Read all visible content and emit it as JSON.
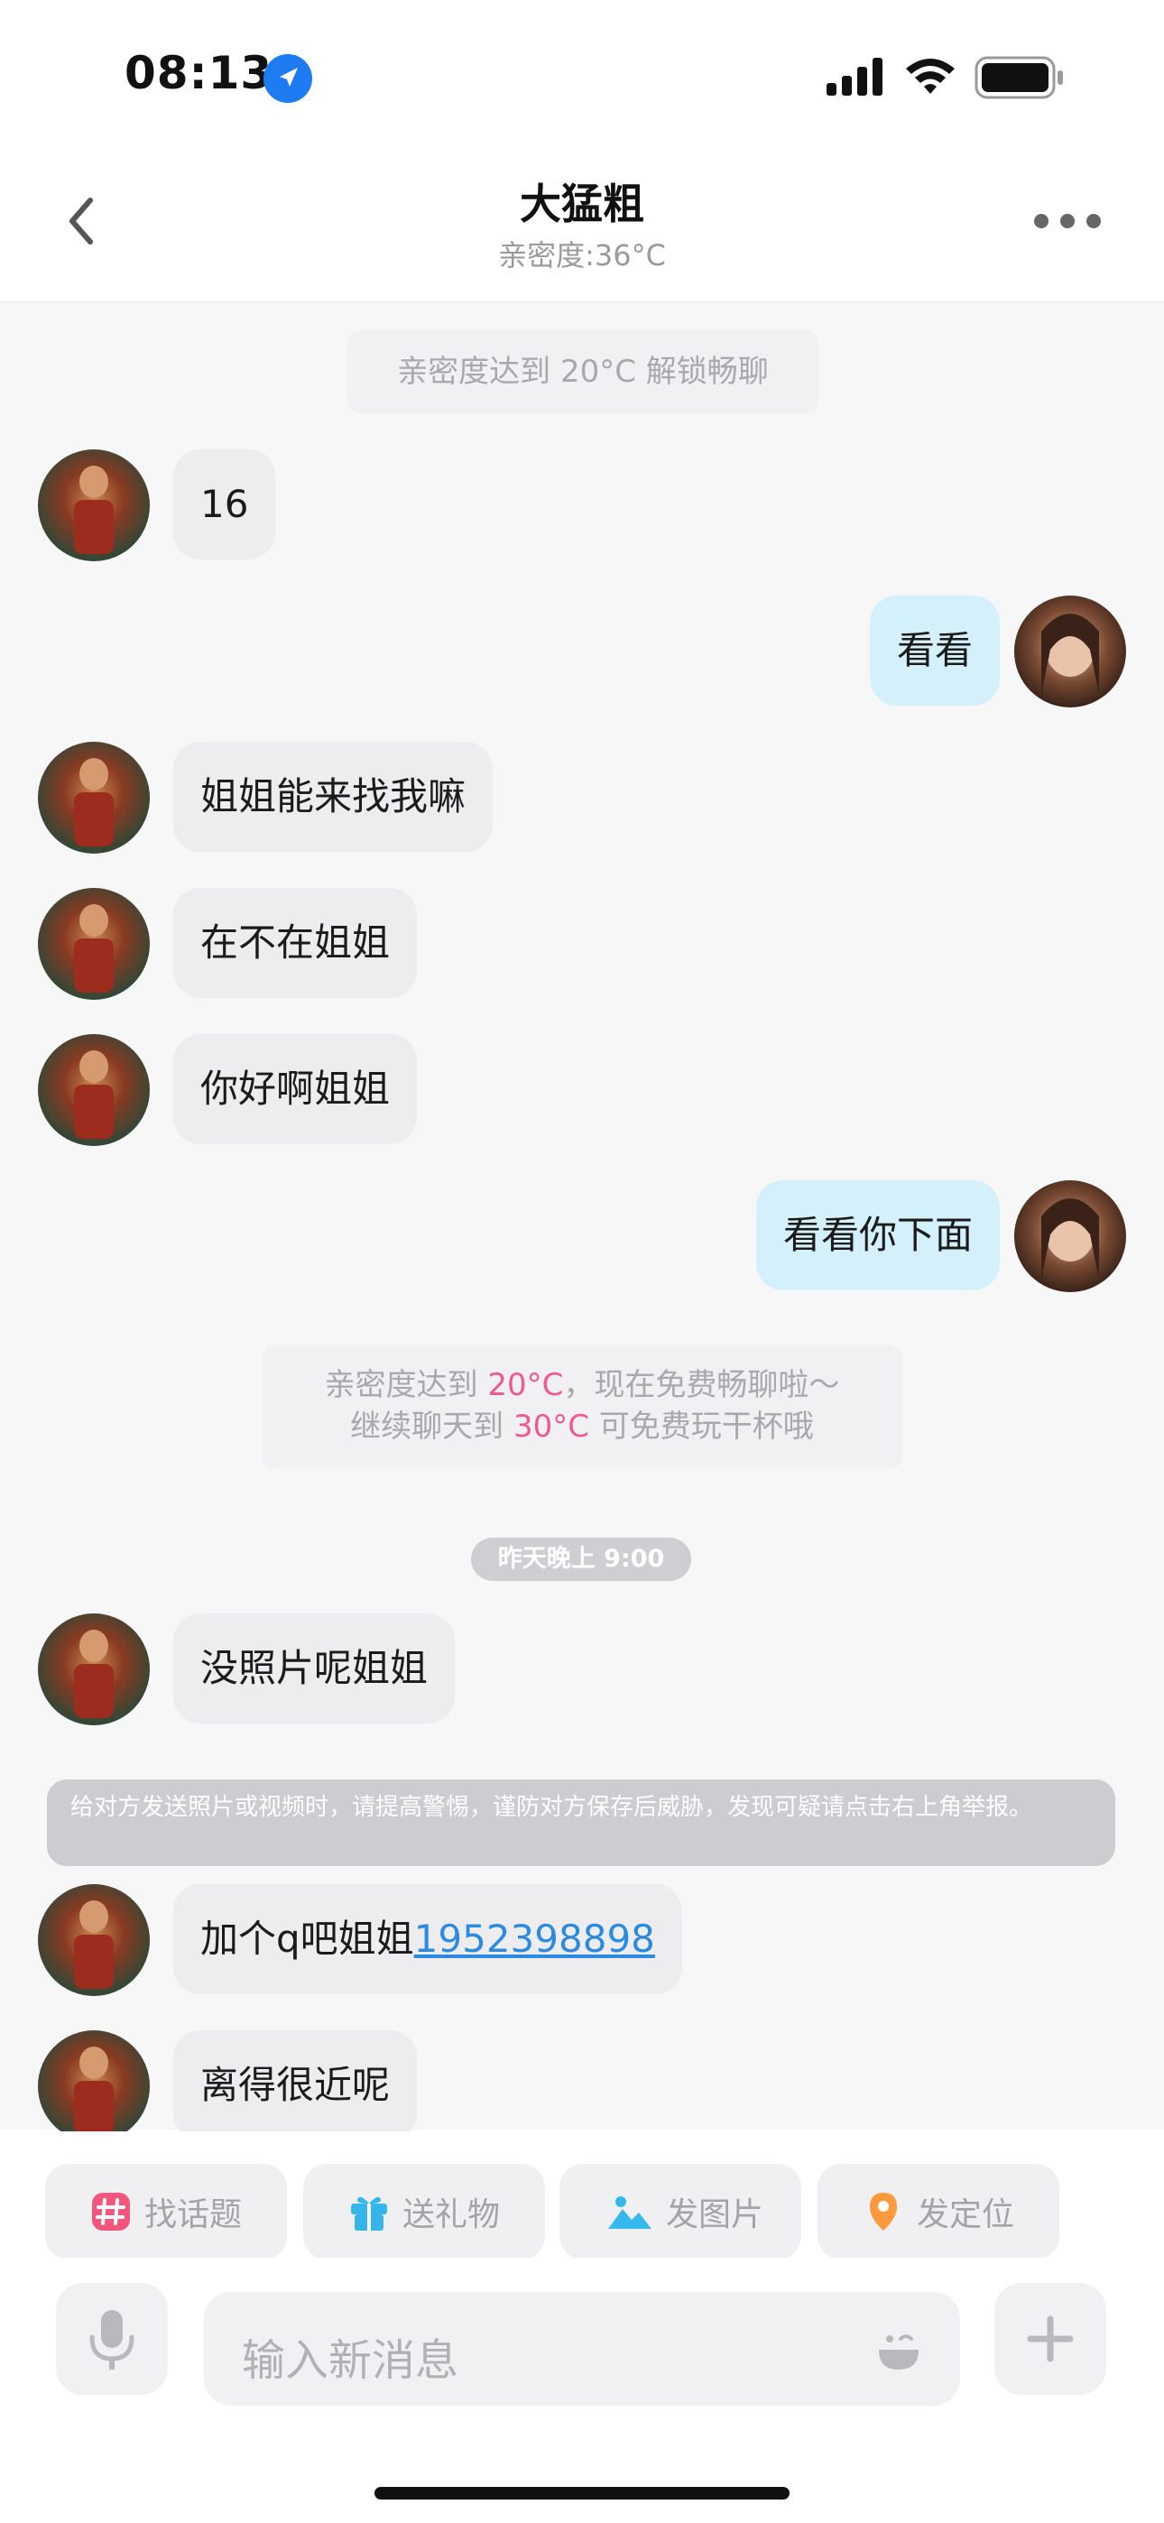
{
  "status_bar": {
    "time": "08:13",
    "icons": [
      "location-arrow-icon",
      "cellular-signal-icon",
      "wifi-icon",
      "battery-icon"
    ]
  },
  "header": {
    "title": "大猛粗",
    "subtitle": "亲密度:36°C",
    "icons": [
      "back-chevron-icon",
      "more-dots-icon"
    ]
  },
  "system": {
    "unlock_notice": "亲密度达到 20°C 解锁畅聊",
    "intimacy_line1_pre": "亲密度达到 ",
    "intimacy_line1_temp": "20°C",
    "intimacy_line1_post": "，现在免费畅聊啦～",
    "intimacy_line2_pre": "继续聊天到 ",
    "intimacy_line2_temp": "30°C",
    "intimacy_line2_post": " 可免费玩干杯哦",
    "timestamp": "昨天晚上 9:00",
    "warning": "给对方发送照片或视频时，请提高警惕，谨防对方保存后威胁，发现可疑请点击右上角举报。"
  },
  "messages": [
    {
      "side": "in",
      "text": "16"
    },
    {
      "side": "out",
      "text": "看看"
    },
    {
      "side": "in",
      "text": "姐姐能来找我嘛"
    },
    {
      "side": "in",
      "text": "在不在姐姐"
    },
    {
      "side": "in",
      "text": "你好啊姐姐"
    },
    {
      "side": "out",
      "text": "看看你下面"
    },
    {
      "side": "in",
      "text": "没照片呢姐姐"
    },
    {
      "side": "in",
      "text": "加个q吧姐姐",
      "link": "1952398898"
    },
    {
      "side": "in",
      "text": "离得很近呢"
    }
  ],
  "quick_actions": [
    {
      "label": "找话题",
      "icon": "hashtag-icon",
      "color": "#f2567c"
    },
    {
      "label": "送礼物",
      "icon": "gift-icon",
      "color": "#36b6e8"
    },
    {
      "label": "发图片",
      "icon": "image-icon",
      "color": "#35b8ea"
    },
    {
      "label": "发定位",
      "icon": "location-pin-icon",
      "color": "#ff9a3c"
    }
  ],
  "input": {
    "placeholder": "输入新消息",
    "icons": [
      "microphone-icon",
      "emoji-icon",
      "plus-icon"
    ]
  },
  "colors": {
    "accent_pink": "#ee5a8f",
    "out_bubble": "#d3f0fb",
    "link": "#2c8be0"
  }
}
